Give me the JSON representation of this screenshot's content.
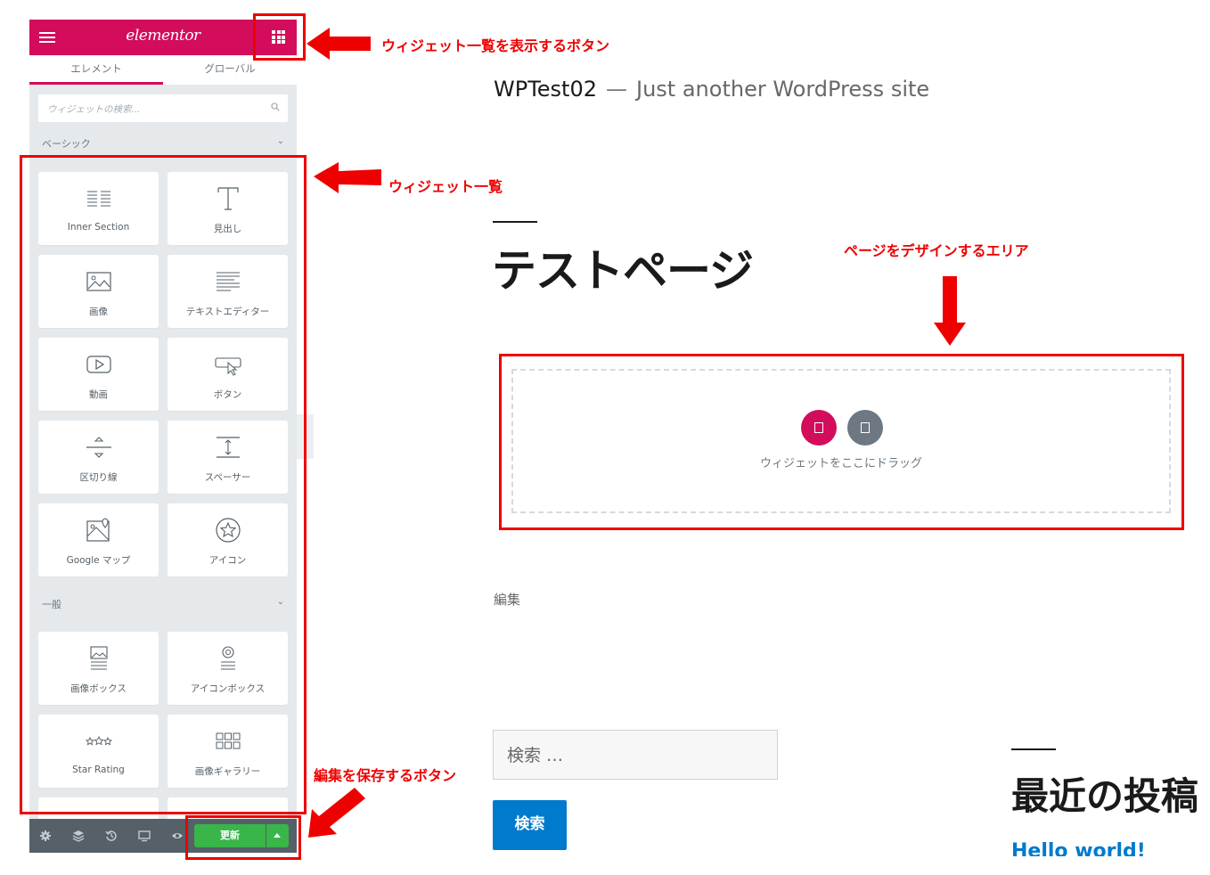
{
  "panel": {
    "logo": "elementor",
    "tabs": [
      {
        "label": "エレメント",
        "active": true
      },
      {
        "label": "グローバル",
        "active": false
      }
    ],
    "search_placeholder": "ウィジェットの検索...",
    "categories": [
      {
        "title": "ベーシック"
      },
      {
        "title": "一般"
      }
    ],
    "widgets": [
      {
        "label": "Inner Section",
        "icon": "inner-section-icon"
      },
      {
        "label": "見出し",
        "icon": "heading-icon"
      },
      {
        "label": "画像",
        "icon": "image-icon"
      },
      {
        "label": "テキストエディター",
        "icon": "text-editor-icon"
      },
      {
        "label": "動画",
        "icon": "video-icon"
      },
      {
        "label": "ボタン",
        "icon": "button-icon"
      },
      {
        "label": "区切り線",
        "icon": "divider-icon"
      },
      {
        "label": "スペーサー",
        "icon": "spacer-icon"
      },
      {
        "label": "Google マップ",
        "icon": "google-maps-icon"
      },
      {
        "label": "アイコン",
        "icon": "star-circle-icon"
      },
      {
        "label": "画像ボックス",
        "icon": "image-box-icon"
      },
      {
        "label": "アイコンボックス",
        "icon": "icon-box-icon"
      },
      {
        "label": "Star Rating",
        "icon": "star-rating-icon"
      },
      {
        "label": "画像ギャラリー",
        "icon": "image-gallery-icon"
      }
    ],
    "footer": {
      "update_label": "更新"
    },
    "colors": {
      "brand": "#d30c5c",
      "update": "#39b54a",
      "footer": "#556068"
    }
  },
  "annotations": {
    "widget_list_button": "ウィジェット一覧を表示するボタン",
    "widget_list": "ウィジェット一覧",
    "design_area": "ページをデザインするエリア",
    "save_button": "編集を保存するボタン",
    "color": "#ee0000"
  },
  "site": {
    "title": "WPTest02",
    "separator": "—",
    "tagline": "Just another WordPress site",
    "page_title": "テストページ",
    "dropzone_text": "ウィジェットをここにドラッグ",
    "edit_link": "編集",
    "search_placeholder": "検索 …",
    "search_button": "検索",
    "recent_posts_title": "最近の投稿",
    "recent_post_link": "Hello world!"
  }
}
